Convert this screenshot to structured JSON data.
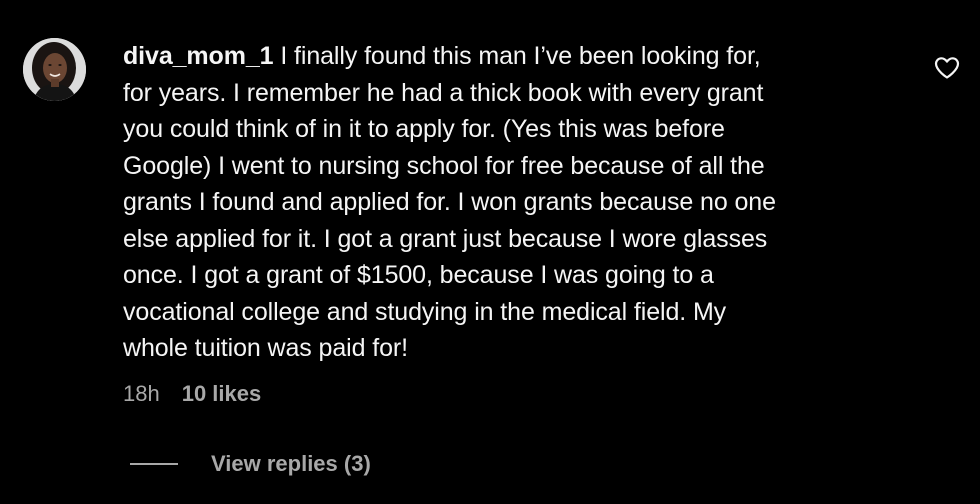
{
  "comment": {
    "username": "diva_mom_1",
    "avatar_icon": "profile-photo-avatar",
    "lines": [
      "I finally found this man I’ve been looking for,",
      "for years. I remember he had a thick book with every grant",
      "you could think of in it to apply for. (Yes this was before",
      "Google) I went to nursing school for free because of all the",
      "grants I found and applied for. I won grants because no one",
      "else applied for it. I got a grant just because I wore glasses",
      "once. I got a grant of $1500, because I was going to a",
      "vocational college and studying in the medical field. My",
      "whole tuition was paid for!"
    ],
    "time": "18h",
    "likes": "10 likes",
    "like_icon": "heart-outline-icon",
    "view_replies": "View replies (3)"
  },
  "colors": {
    "background": "#000000",
    "text": "#f5f5f5",
    "secondary_text": "#a8a8a8"
  }
}
